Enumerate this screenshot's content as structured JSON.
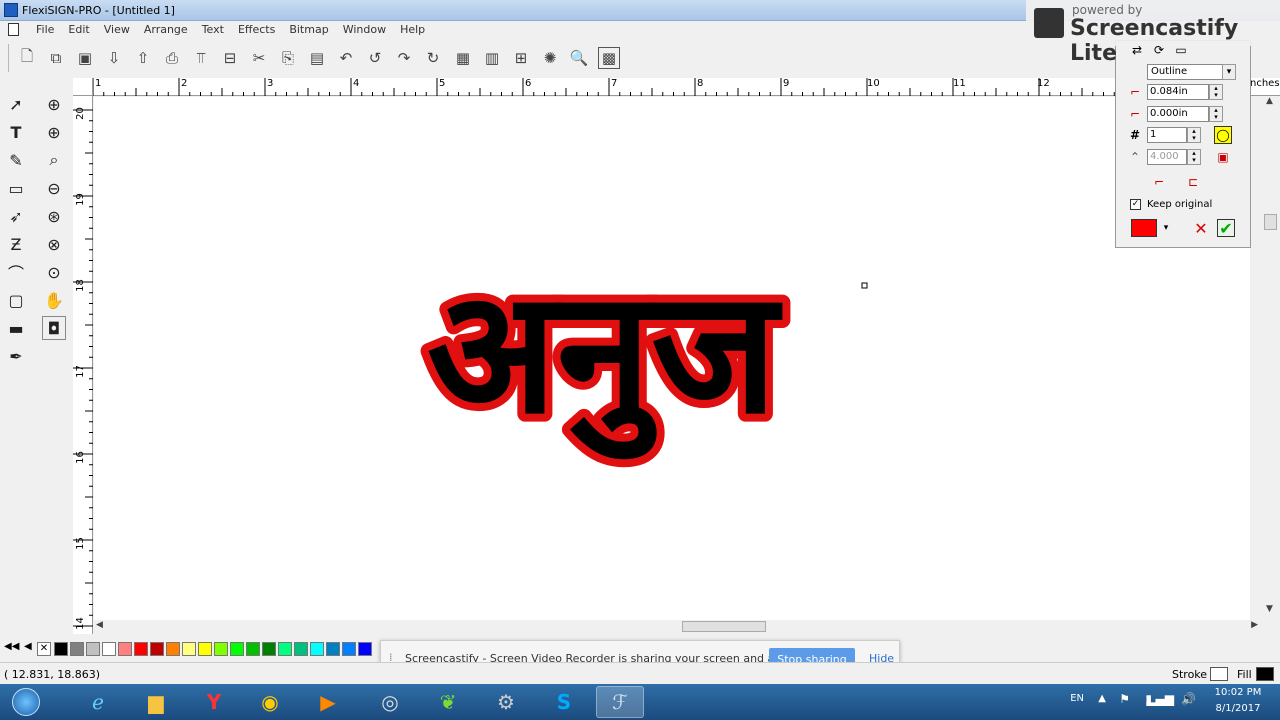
{
  "window": {
    "title": "FlexiSIGN-PRO - [Untitled 1]"
  },
  "menu": [
    "File",
    "Edit",
    "View",
    "Arrange",
    "Text",
    "Effects",
    "Bitmap",
    "Window",
    "Help"
  ],
  "ruler": {
    "top_labels": [
      "1",
      "2",
      "3",
      "4",
      "5",
      "6",
      "7",
      "8",
      "9",
      "10",
      "11",
      "12"
    ],
    "top_right_label": "nches",
    "left_labels": [
      "20",
      "19",
      "18",
      "17",
      "16",
      "15",
      "14"
    ]
  },
  "canvas": {
    "text": "अनुज",
    "fill_color": "#000000",
    "outline_color": "#e01010"
  },
  "panel": {
    "mode": "Outline",
    "width_value": "0.084in",
    "offset_value": "0.000in",
    "count_value": "1",
    "limit_value": "4.000",
    "keep_original_label": "Keep original",
    "keep_original_checked": true,
    "color": "#ff0000"
  },
  "share": {
    "message": "Screencastify - Screen Video Recorder is sharing your screen and audio.",
    "stop_label": "Stop sharing",
    "hide_label": "Hide"
  },
  "status": {
    "coords": "( 12.831,    18.863)",
    "stroke_label": "Stroke",
    "fill_label": "Fill"
  },
  "watermark": {
    "powered": "powered by",
    "brand": "Screencastify Lite"
  },
  "tray": {
    "lang": "EN",
    "time": "10:02 PM",
    "date": "8/1/2017"
  },
  "palette": [
    "#000000",
    "#808080",
    "#c0c0c0",
    "#ffffff",
    "#ff8080",
    "#ff0000",
    "#c00000",
    "#ff8000",
    "#ffff80",
    "#ffff00",
    "#80ff00",
    "#00ff00",
    "#00c000",
    "#008000",
    "#00ff80",
    "#00c080",
    "#00ffff",
    "#0080c0",
    "#0080ff",
    "#0000ff"
  ]
}
